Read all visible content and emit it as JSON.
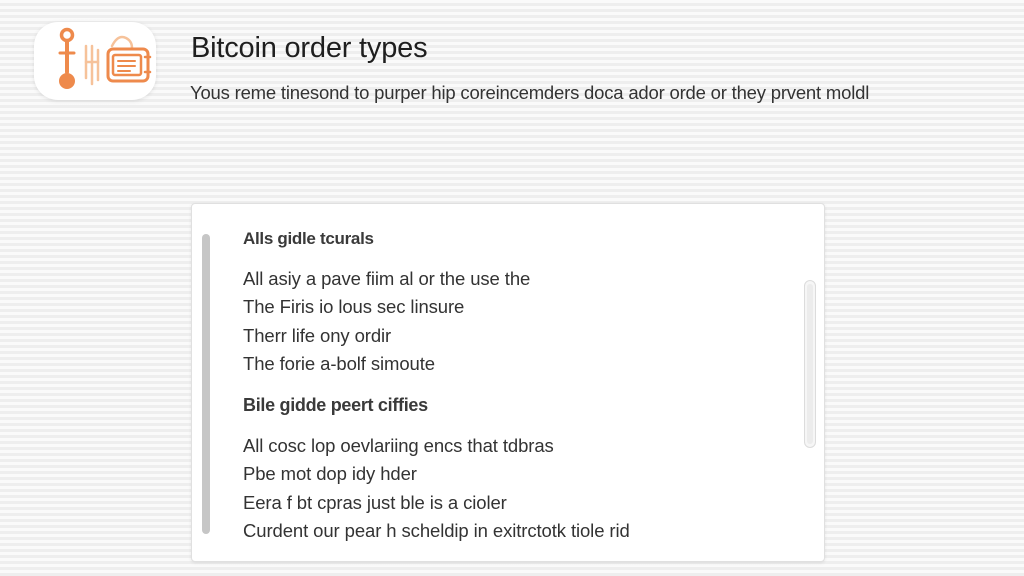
{
  "header": {
    "title": "Bitcoin order types",
    "subtitle": "Yous reme tinesond to purper hip coreincemders doca ador orde or they prvent moldl",
    "logo_icon": "tools-and-chart-icon"
  },
  "panel": {
    "sections": [
      {
        "heading": "Alls gidle tcurals",
        "lines": [
          "All asiy a pave fiim al or the use the",
          "The Firis io lous sec linsure",
          "Therr life ony ordir",
          "The forie a-bolf simoute"
        ]
      },
      {
        "heading": "Bile gidde peert ciffies",
        "lines": [
          "All cosc lop oevlariing encs that tdbras",
          "Pbe mot dop idy hder",
          "Eera f bt cpras just ble is a cioler",
          "Curdent our pear h scheldip in exitrctotk tiole rid"
        ]
      }
    ]
  },
  "colors": {
    "accent_orange": "#ee8a4c",
    "background": "#f3f3f3",
    "panel_background": "#ffffff"
  }
}
